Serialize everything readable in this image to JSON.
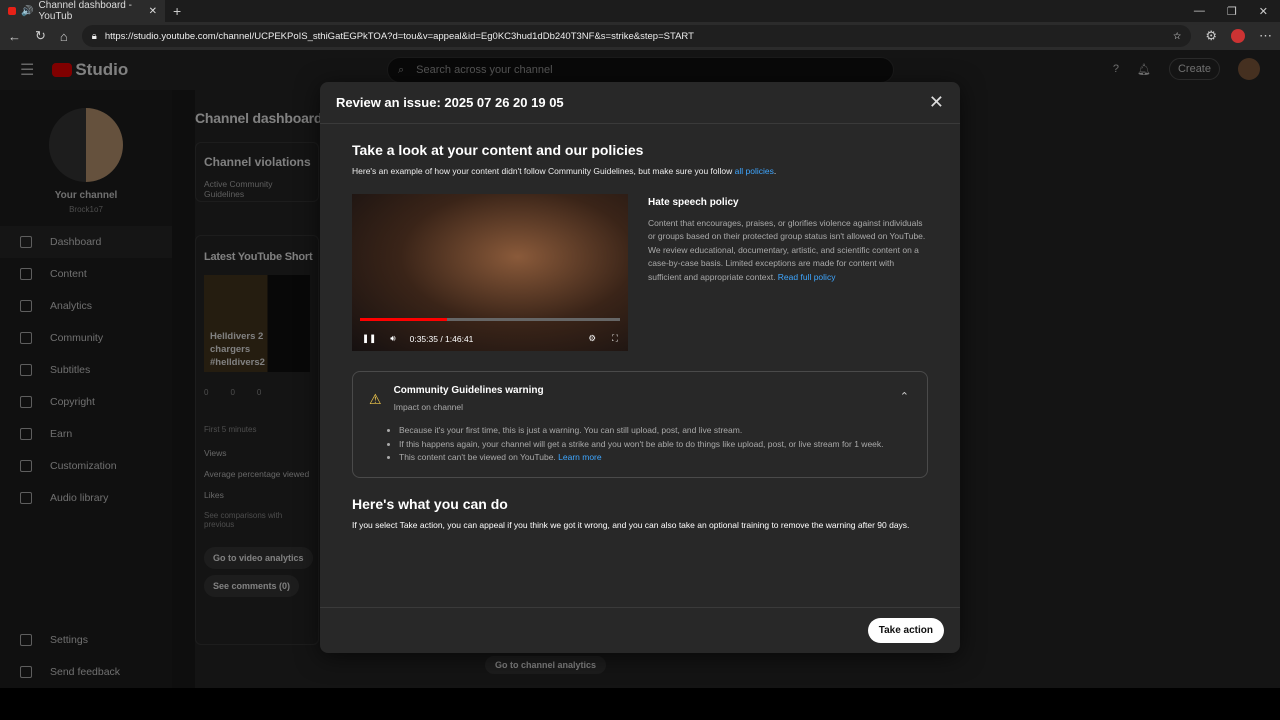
{
  "browser": {
    "tab_title": "Channel dashboard - YouTub",
    "url": "https://studio.youtube.com/channel/UCPEKPoIS_sthiGatEGPkTOA?d=tou&v=appeal&id=Eg0KC3hud1dDb240T3NF&s=strike&step=START"
  },
  "header": {
    "logo": "Studio",
    "search_placeholder": "Search across your channel",
    "create": "Create"
  },
  "sidebar": {
    "channel_label": "Your channel",
    "handle": "Brock1o7",
    "items": [
      {
        "label": "Dashboard",
        "icon": "dashboard-icon"
      },
      {
        "label": "Content",
        "icon": "content-icon"
      },
      {
        "label": "Analytics",
        "icon": "analytics-icon"
      },
      {
        "label": "Community",
        "icon": "community-icon"
      },
      {
        "label": "Subtitles",
        "icon": "subtitles-icon"
      },
      {
        "label": "Copyright",
        "icon": "copyright-icon"
      },
      {
        "label": "Earn",
        "icon": "earn-icon"
      },
      {
        "label": "Customization",
        "icon": "customization-icon"
      },
      {
        "label": "Audio library",
        "icon": "audio-library-icon"
      }
    ],
    "bottom": [
      {
        "label": "Settings"
      },
      {
        "label": "Send feedback"
      }
    ]
  },
  "dashboard": {
    "title": "Channel dashboard",
    "violations_title": "Channel violations",
    "violations_text": "Active Community Guidelines",
    "shorts_title": "Latest YouTube Short",
    "short_title": "Helldivers 2 chargers #helldivers2",
    "stats": [
      "0",
      "0",
      "0"
    ],
    "period": "First 5 minutes",
    "metrics": [
      "Views",
      "Average percentage viewed",
      "Likes"
    ],
    "compare": "See comparisons with previous",
    "btn_analytics": "Go to video analytics",
    "btn_comments": "See comments (0)",
    "btn_channel": "Go to channel analytics"
  },
  "modal": {
    "title": "Review an issue: 2025 07 26 20 19 05",
    "section1_title": "Take a look at your content and our policies",
    "section1_text": "Here's an example of how your content didn't follow Community Guidelines, but make sure you follow ",
    "section1_link": "all policies",
    "video": {
      "time": "0:35:35 / 1:46:41",
      "progress": 0.334
    },
    "policy_title": "Hate speech policy",
    "policy_text": "Content that encourages, praises, or glorifies violence against individuals or groups based on their protected group status isn't allowed on YouTube. We review educational, documentary, artistic, and scientific content on a case-by-case basis. Limited exceptions are made for content with sufficient and appropriate context. ",
    "policy_link": "Read full policy",
    "warning": {
      "title": "Community Guidelines warning",
      "subtitle": "Impact on channel",
      "bullets": [
        "Because it's your first time, this is just a warning. You can still upload, post, and live stream.",
        "If this happens again, your channel will get a strike and you won't be able to do things like upload, post, or live stream for 1 week.",
        "This content can't be viewed on YouTube. "
      ],
      "learn_more": "Learn more",
      "color": "#f2c94c"
    },
    "section2_title": "Here's what you can do",
    "section2_text": "If you select Take action, you can appeal if you think we got it wrong, and you can also take an optional training to remove the warning after 90 days.",
    "take_action": "Take action"
  }
}
